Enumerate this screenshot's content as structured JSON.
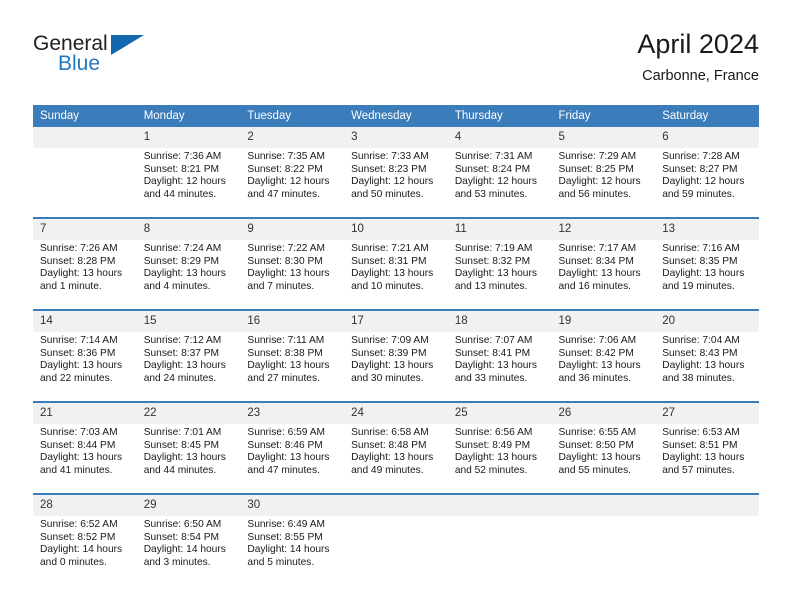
{
  "logo": {
    "word1": "General",
    "word2": "Blue",
    "triangle_color": "#1367ad",
    "blue_color": "#1f78c1"
  },
  "header": {
    "title": "April 2024",
    "subtitle": "Carbonne, France"
  },
  "colors": {
    "header_bg": "#3b7cba",
    "header_text": "#ffffff",
    "daynum_bg": "#f1f1f1",
    "rule": "#3b7cba"
  },
  "weekdays": [
    "Sunday",
    "Monday",
    "Tuesday",
    "Wednesday",
    "Thursday",
    "Friday",
    "Saturday"
  ],
  "weeks": [
    [
      {
        "day": "",
        "blank": true,
        "sunrise": "",
        "sunset": "",
        "daylight1": "",
        "daylight2": ""
      },
      {
        "day": "1",
        "sunrise": "Sunrise: 7:36 AM",
        "sunset": "Sunset: 8:21 PM",
        "daylight1": "Daylight: 12 hours",
        "daylight2": "and 44 minutes."
      },
      {
        "day": "2",
        "sunrise": "Sunrise: 7:35 AM",
        "sunset": "Sunset: 8:22 PM",
        "daylight1": "Daylight: 12 hours",
        "daylight2": "and 47 minutes."
      },
      {
        "day": "3",
        "sunrise": "Sunrise: 7:33 AM",
        "sunset": "Sunset: 8:23 PM",
        "daylight1": "Daylight: 12 hours",
        "daylight2": "and 50 minutes."
      },
      {
        "day": "4",
        "sunrise": "Sunrise: 7:31 AM",
        "sunset": "Sunset: 8:24 PM",
        "daylight1": "Daylight: 12 hours",
        "daylight2": "and 53 minutes."
      },
      {
        "day": "5",
        "sunrise": "Sunrise: 7:29 AM",
        "sunset": "Sunset: 8:25 PM",
        "daylight1": "Daylight: 12 hours",
        "daylight2": "and 56 minutes."
      },
      {
        "day": "6",
        "sunrise": "Sunrise: 7:28 AM",
        "sunset": "Sunset: 8:27 PM",
        "daylight1": "Daylight: 12 hours",
        "daylight2": "and 59 minutes."
      }
    ],
    [
      {
        "day": "7",
        "sunrise": "Sunrise: 7:26 AM",
        "sunset": "Sunset: 8:28 PM",
        "daylight1": "Daylight: 13 hours",
        "daylight2": "and 1 minute."
      },
      {
        "day": "8",
        "sunrise": "Sunrise: 7:24 AM",
        "sunset": "Sunset: 8:29 PM",
        "daylight1": "Daylight: 13 hours",
        "daylight2": "and 4 minutes."
      },
      {
        "day": "9",
        "sunrise": "Sunrise: 7:22 AM",
        "sunset": "Sunset: 8:30 PM",
        "daylight1": "Daylight: 13 hours",
        "daylight2": "and 7 minutes."
      },
      {
        "day": "10",
        "sunrise": "Sunrise: 7:21 AM",
        "sunset": "Sunset: 8:31 PM",
        "daylight1": "Daylight: 13 hours",
        "daylight2": "and 10 minutes."
      },
      {
        "day": "11",
        "sunrise": "Sunrise: 7:19 AM",
        "sunset": "Sunset: 8:32 PM",
        "daylight1": "Daylight: 13 hours",
        "daylight2": "and 13 minutes."
      },
      {
        "day": "12",
        "sunrise": "Sunrise: 7:17 AM",
        "sunset": "Sunset: 8:34 PM",
        "daylight1": "Daylight: 13 hours",
        "daylight2": "and 16 minutes."
      },
      {
        "day": "13",
        "sunrise": "Sunrise: 7:16 AM",
        "sunset": "Sunset: 8:35 PM",
        "daylight1": "Daylight: 13 hours",
        "daylight2": "and 19 minutes."
      }
    ],
    [
      {
        "day": "14",
        "sunrise": "Sunrise: 7:14 AM",
        "sunset": "Sunset: 8:36 PM",
        "daylight1": "Daylight: 13 hours",
        "daylight2": "and 22 minutes."
      },
      {
        "day": "15",
        "sunrise": "Sunrise: 7:12 AM",
        "sunset": "Sunset: 8:37 PM",
        "daylight1": "Daylight: 13 hours",
        "daylight2": "and 24 minutes."
      },
      {
        "day": "16",
        "sunrise": "Sunrise: 7:11 AM",
        "sunset": "Sunset: 8:38 PM",
        "daylight1": "Daylight: 13 hours",
        "daylight2": "and 27 minutes."
      },
      {
        "day": "17",
        "sunrise": "Sunrise: 7:09 AM",
        "sunset": "Sunset: 8:39 PM",
        "daylight1": "Daylight: 13 hours",
        "daylight2": "and 30 minutes."
      },
      {
        "day": "18",
        "sunrise": "Sunrise: 7:07 AM",
        "sunset": "Sunset: 8:41 PM",
        "daylight1": "Daylight: 13 hours",
        "daylight2": "and 33 minutes."
      },
      {
        "day": "19",
        "sunrise": "Sunrise: 7:06 AM",
        "sunset": "Sunset: 8:42 PM",
        "daylight1": "Daylight: 13 hours",
        "daylight2": "and 36 minutes."
      },
      {
        "day": "20",
        "sunrise": "Sunrise: 7:04 AM",
        "sunset": "Sunset: 8:43 PM",
        "daylight1": "Daylight: 13 hours",
        "daylight2": "and 38 minutes."
      }
    ],
    [
      {
        "day": "21",
        "sunrise": "Sunrise: 7:03 AM",
        "sunset": "Sunset: 8:44 PM",
        "daylight1": "Daylight: 13 hours",
        "daylight2": "and 41 minutes."
      },
      {
        "day": "22",
        "sunrise": "Sunrise: 7:01 AM",
        "sunset": "Sunset: 8:45 PM",
        "daylight1": "Daylight: 13 hours",
        "daylight2": "and 44 minutes."
      },
      {
        "day": "23",
        "sunrise": "Sunrise: 6:59 AM",
        "sunset": "Sunset: 8:46 PM",
        "daylight1": "Daylight: 13 hours",
        "daylight2": "and 47 minutes."
      },
      {
        "day": "24",
        "sunrise": "Sunrise: 6:58 AM",
        "sunset": "Sunset: 8:48 PM",
        "daylight1": "Daylight: 13 hours",
        "daylight2": "and 49 minutes."
      },
      {
        "day": "25",
        "sunrise": "Sunrise: 6:56 AM",
        "sunset": "Sunset: 8:49 PM",
        "daylight1": "Daylight: 13 hours",
        "daylight2": "and 52 minutes."
      },
      {
        "day": "26",
        "sunrise": "Sunrise: 6:55 AM",
        "sunset": "Sunset: 8:50 PM",
        "daylight1": "Daylight: 13 hours",
        "daylight2": "and 55 minutes."
      },
      {
        "day": "27",
        "sunrise": "Sunrise: 6:53 AM",
        "sunset": "Sunset: 8:51 PM",
        "daylight1": "Daylight: 13 hours",
        "daylight2": "and 57 minutes."
      }
    ],
    [
      {
        "day": "28",
        "sunrise": "Sunrise: 6:52 AM",
        "sunset": "Sunset: 8:52 PM",
        "daylight1": "Daylight: 14 hours",
        "daylight2": "and 0 minutes."
      },
      {
        "day": "29",
        "sunrise": "Sunrise: 6:50 AM",
        "sunset": "Sunset: 8:54 PM",
        "daylight1": "Daylight: 14 hours",
        "daylight2": "and 3 minutes."
      },
      {
        "day": "30",
        "sunrise": "Sunrise: 6:49 AM",
        "sunset": "Sunset: 8:55 PM",
        "daylight1": "Daylight: 14 hours",
        "daylight2": "and 5 minutes."
      },
      {
        "day": "",
        "blank": true,
        "sunrise": "",
        "sunset": "",
        "daylight1": "",
        "daylight2": ""
      },
      {
        "day": "",
        "blank": true,
        "sunrise": "",
        "sunset": "",
        "daylight1": "",
        "daylight2": ""
      },
      {
        "day": "",
        "blank": true,
        "sunrise": "",
        "sunset": "",
        "daylight1": "",
        "daylight2": ""
      },
      {
        "day": "",
        "blank": true,
        "sunrise": "",
        "sunset": "",
        "daylight1": "",
        "daylight2": ""
      }
    ]
  ]
}
